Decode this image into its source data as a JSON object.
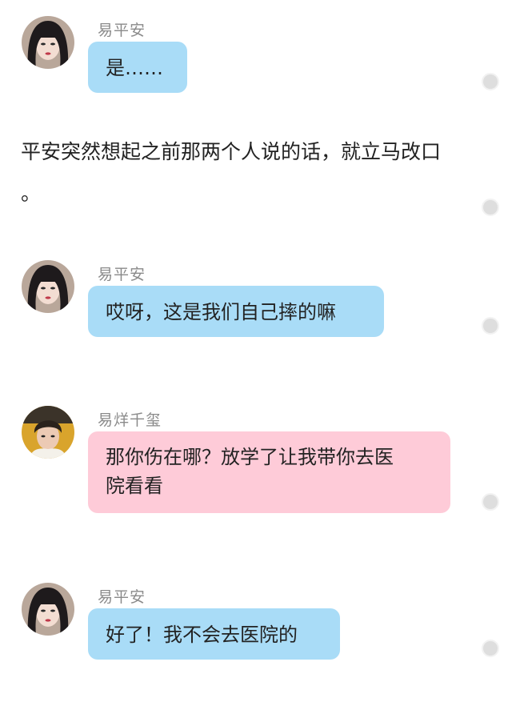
{
  "messages": [
    {
      "sender": "易平安",
      "text": "是……"
    },
    {
      "narration": "平安突然想起之前那两个人说的话，就立马改口\n。"
    },
    {
      "sender": "易平安",
      "text": "哎呀，这是我们自己摔的嘛"
    },
    {
      "sender": "易烊千玺",
      "text": "那你伤在哪？放学了让我带你去医\n院看看"
    },
    {
      "sender": "易平安",
      "text": "好了！我不会去医院的"
    }
  ],
  "colors": {
    "blue_bubble": "#a9dcf7",
    "pink_bubble": "#fecbd8",
    "name_text": "#8a8a8a"
  },
  "icons": [
    "avatar-girl",
    "avatar-boy",
    "more-dot"
  ]
}
